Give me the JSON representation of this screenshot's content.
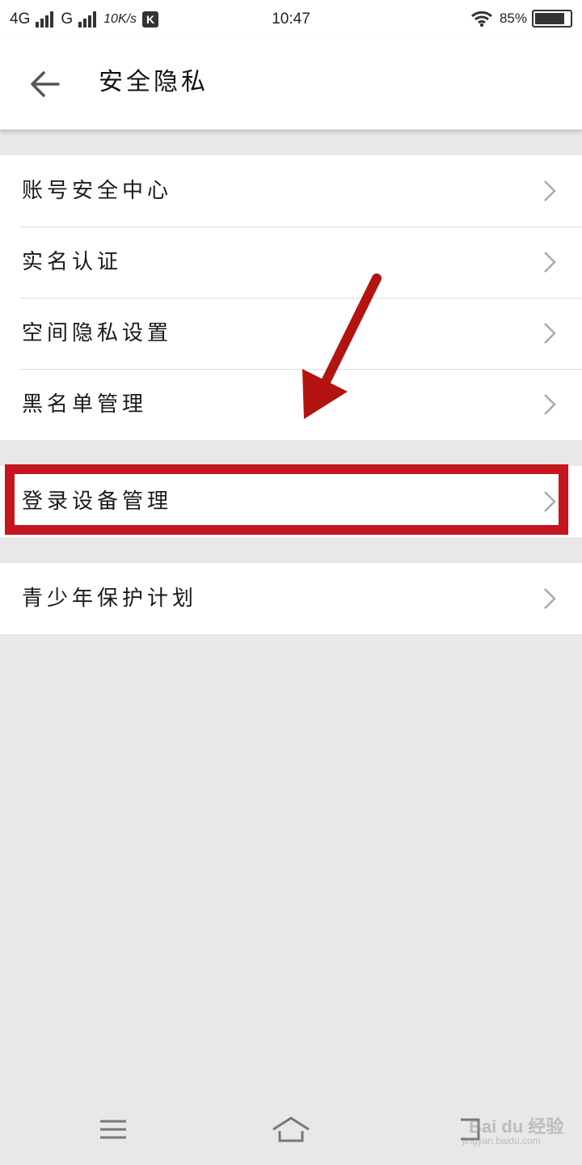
{
  "status_bar": {
    "network_1": "4G",
    "network_2": "G",
    "speed": "10K/s",
    "k_badge": "K",
    "time": "10:47",
    "battery": "85%",
    "battery_level": 0.85
  },
  "header": {
    "title": "安全隐私",
    "back_icon": "arrow-left-icon"
  },
  "settings": {
    "group1": [
      {
        "label": "账号安全中心"
      },
      {
        "label": "实名认证"
      },
      {
        "label": "空间隐私设置"
      },
      {
        "label": "黑名单管理"
      }
    ],
    "group2": [
      {
        "label": "登录设备管理"
      }
    ],
    "group3": [
      {
        "label": "青少年保护计划"
      }
    ]
  },
  "annotation": {
    "highlight_color": "#c4161c"
  },
  "bottom_nav": {
    "menu_icon": "menu-icon",
    "home_icon": "home-icon",
    "back_icon": "back-icon"
  },
  "watermark": {
    "brand": "Bai du 经验",
    "url": "jingyan.baidu.com"
  }
}
